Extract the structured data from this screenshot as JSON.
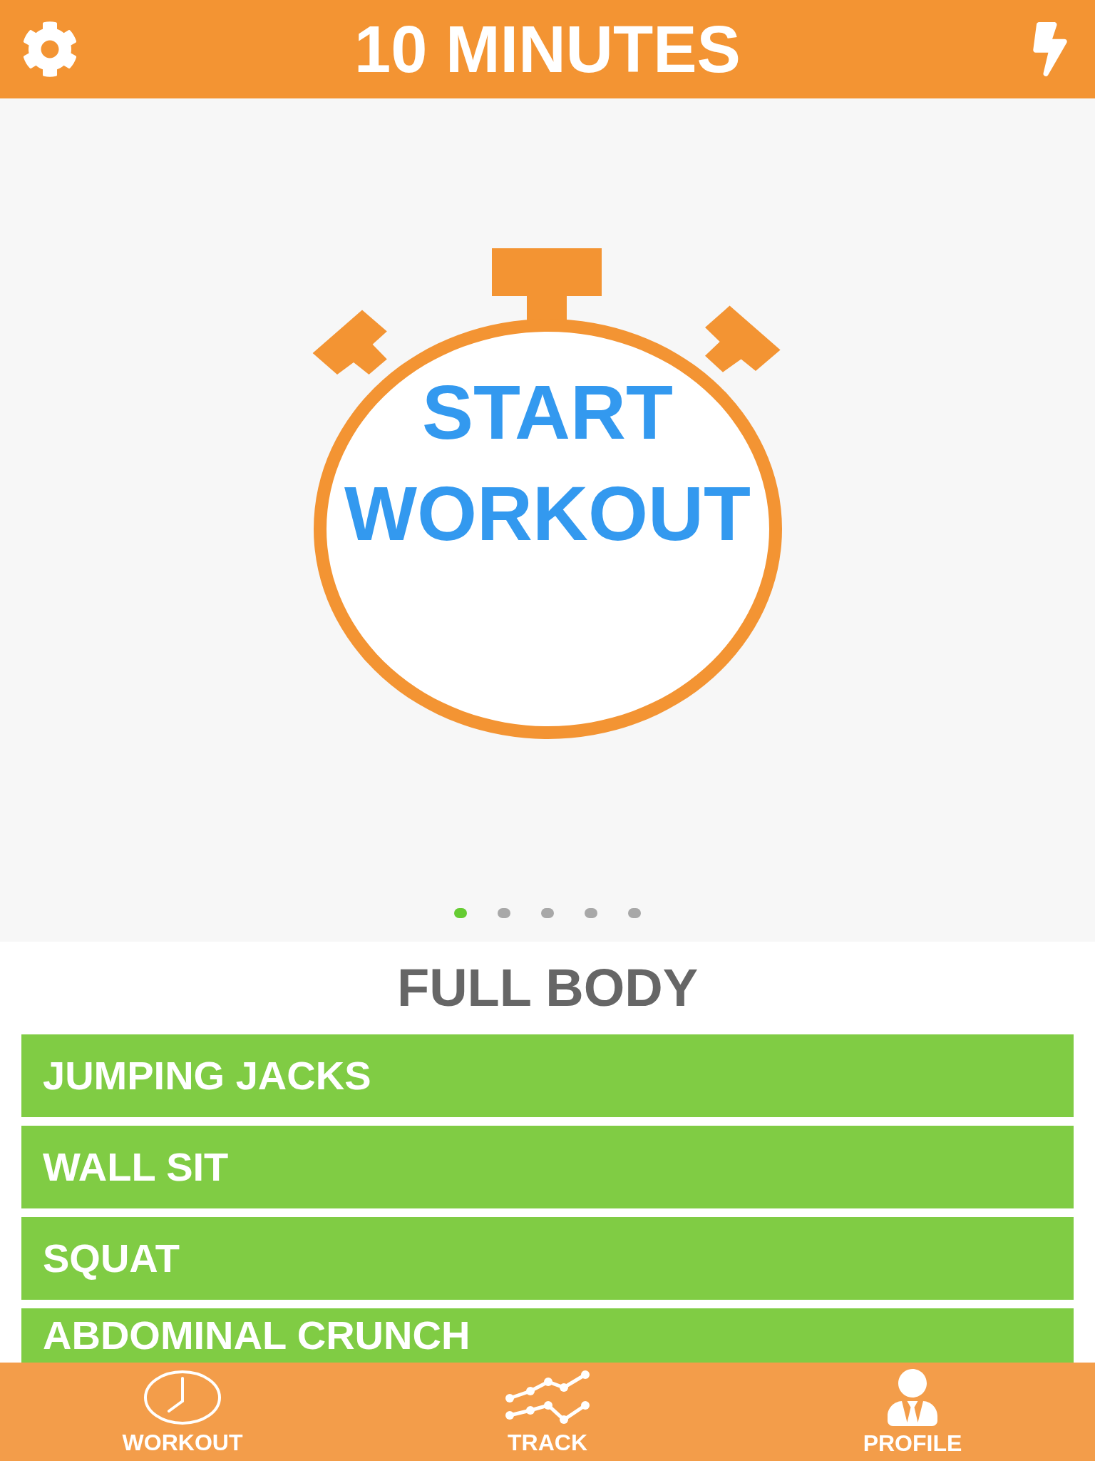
{
  "header": {
    "title": "10 MINUTES"
  },
  "start_button": {
    "label": "START WORKOUT"
  },
  "page_dots": [
    {
      "selected": true
    },
    {
      "selected": false
    },
    {
      "selected": false
    },
    {
      "selected": false
    },
    {
      "selected": false
    }
  ],
  "workout": {
    "title": "FULL BODY",
    "exercises": [
      "JUMPING JACKS",
      "WALL SIT",
      "SQUAT",
      "ABDOMINAL CRUNCH"
    ]
  },
  "tab_bar": [
    {
      "label": "WORKOUT"
    },
    {
      "label": "TRACK"
    },
    {
      "label": "PROFILE"
    }
  ]
}
